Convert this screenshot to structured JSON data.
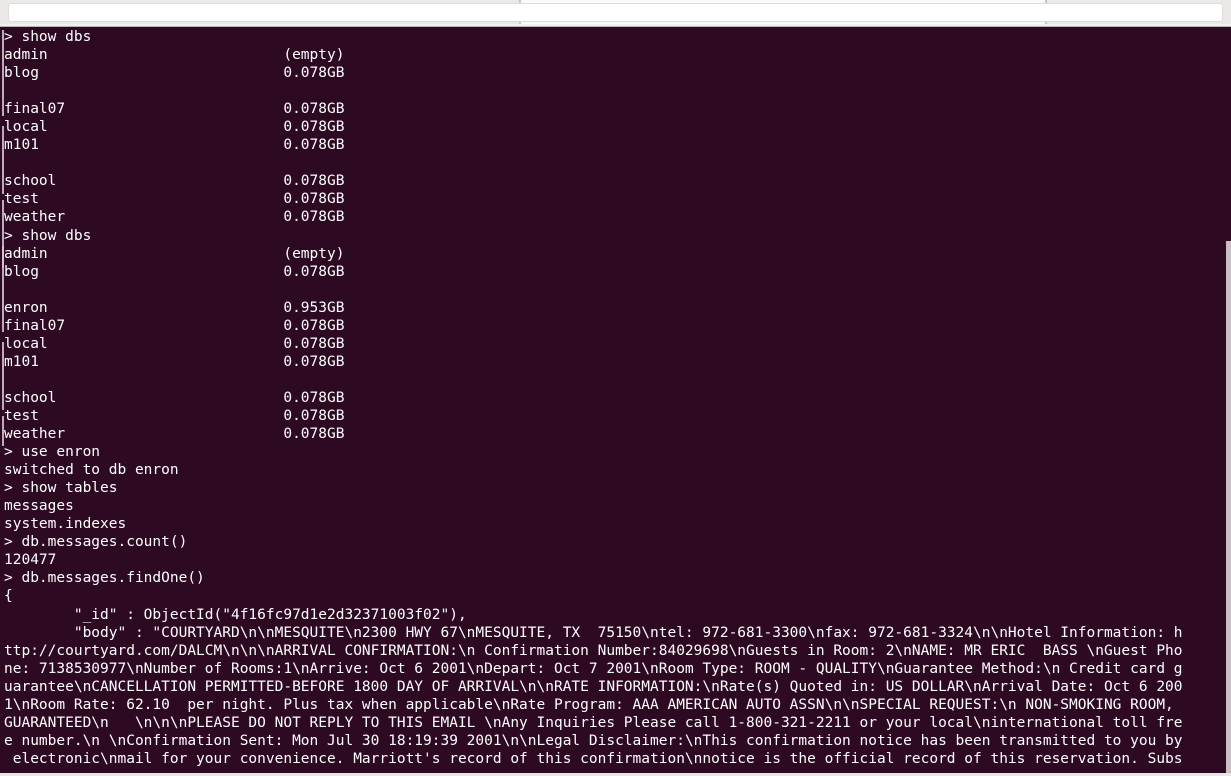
{
  "window": {
    "chrome_background": "#f2f1f0",
    "tabs": [
      {
        "label": ""
      },
      {
        "label": ""
      },
      {
        "label": ""
      }
    ]
  },
  "terminal": {
    "background_color": "#2d0922",
    "foreground_color": "#ffffff",
    "prompt": ">",
    "lines": [
      "> show dbs",
      "admin                           (empty)",
      "blog                            0.078GB",
      "",
      "final07                         0.078GB",
      "local                           0.078GB",
      "m101                            0.078GB",
      "",
      "school                          0.078GB",
      "test                            0.078GB",
      "weather                         0.078GB",
      "> show dbs",
      "admin                           (empty)",
      "blog                            0.078GB",
      "",
      "enron                           0.953GB",
      "final07                         0.078GB",
      "local                           0.078GB",
      "m101                            0.078GB",
      "",
      "school                          0.078GB",
      "test                            0.078GB",
      "weather                         0.078GB",
      "> use enron",
      "switched to db enron",
      "> show tables",
      "messages",
      "system.indexes",
      "> db.messages.count()",
      "120477",
      "> db.messages.findOne()",
      "{",
      "        \"_id\" : ObjectId(\"4f16fc97d1e2d32371003f02\"),",
      "        \"body\" : \"COURTYARD\\n\\nMESQUITE\\n2300 HWY 67\\nMESQUITE, TX  75150\\ntel: 972-681-3300\\nfax: 972-681-3324\\n\\nHotel Information: h",
      "ttp://courtyard.com/DALCM\\n\\n\\nARRIVAL CONFIRMATION:\\n Confirmation Number:84029698\\nGuests in Room: 2\\nNAME: MR ERIC  BASS \\nGuest Pho",
      "ne: 7138530977\\nNumber of Rooms:1\\nArrive: Oct 6 2001\\nDepart: Oct 7 2001\\nRoom Type: ROOM - QUALITY\\nGuarantee Method:\\n Credit card g",
      "uarantee\\nCANCELLATION PERMITTED-BEFORE 1800 DAY OF ARRIVAL\\n\\nRATE INFORMATION:\\nRate(s) Quoted in: US DOLLAR\\nArrival Date: Oct 6 200",
      "1\\nRoom Rate: 62.10  per night. Plus tax when applicable\\nRate Program: AAA AMERICAN AUTO ASSN\\n\\nSPECIAL REQUEST:\\n NON-SMOKING ROOM,",
      "GUARANTEED\\n   \\n\\n\\nPLEASE DO NOT REPLY TO THIS EMAIL \\nAny Inquiries Please call 1-800-321-2211 or your local\\ninternational toll fre",
      "e number.\\n \\nConfirmation Sent: Mon Jul 30 18:19:39 2001\\n\\nLegal Disclaimer:\\nThis confirmation notice has been transmitted to you by",
      " electronic\\nmail for your convenience. Marriott's record of this confirmation\\nnotice is the official record of this reservation. Subs"
    ]
  }
}
